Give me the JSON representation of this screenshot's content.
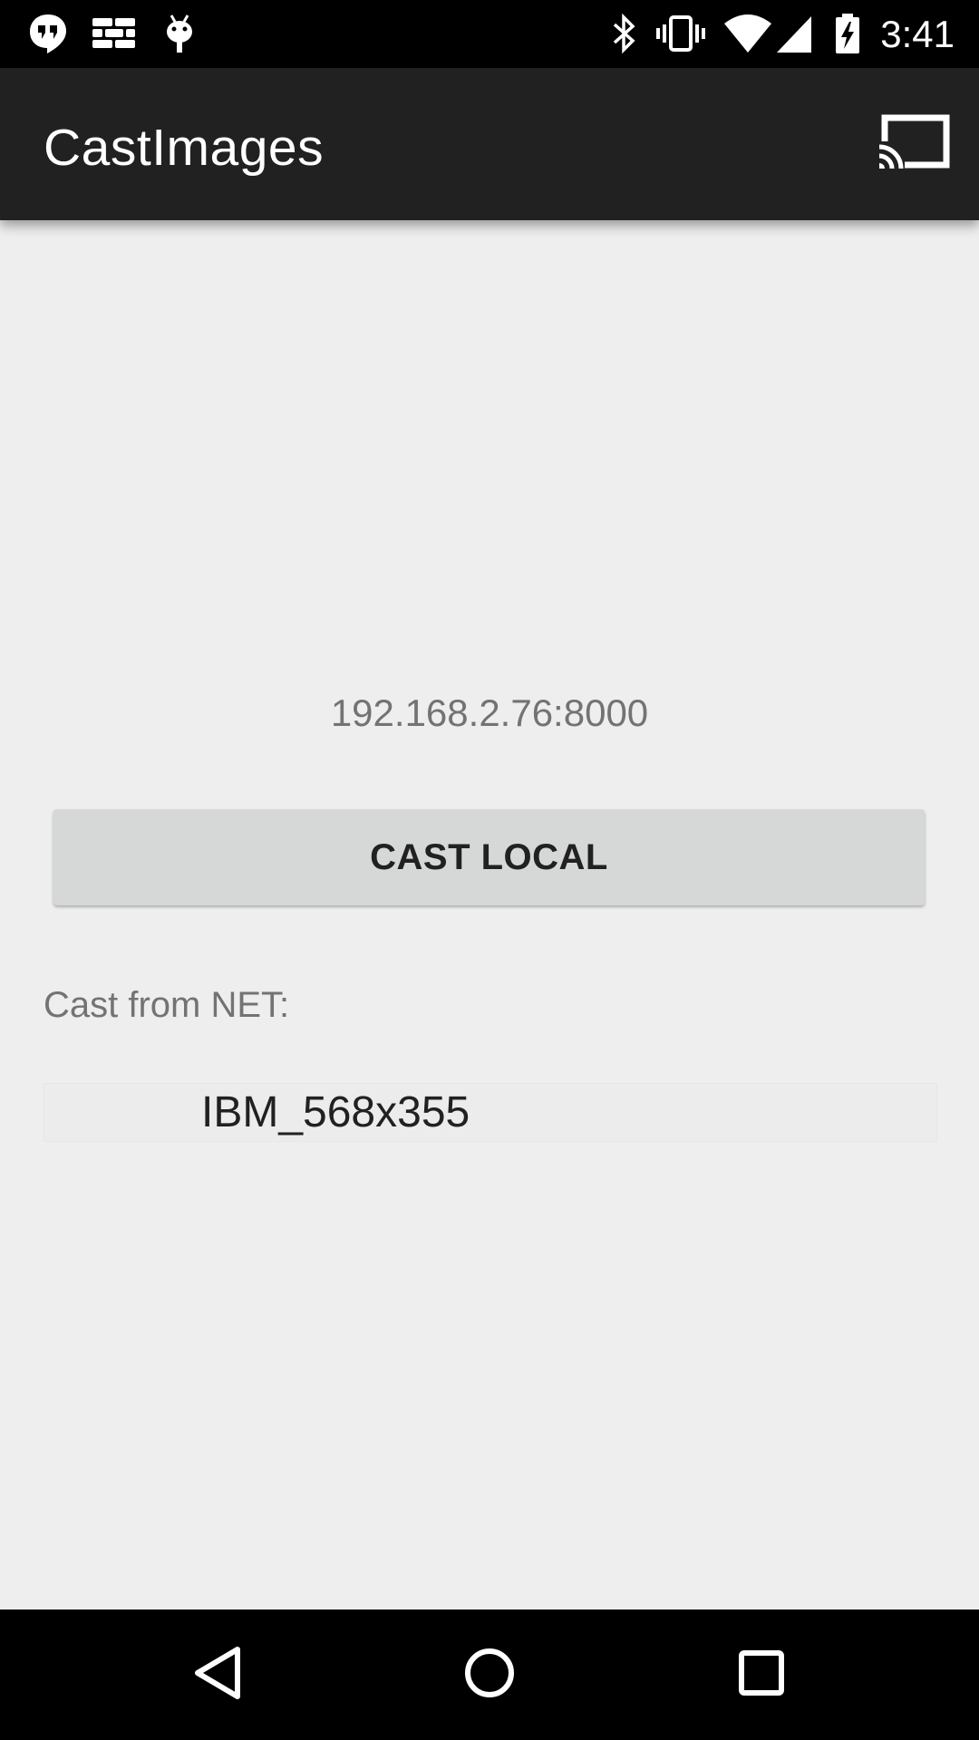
{
  "status_bar": {
    "time": "3:41",
    "left_icons": [
      "hangouts-icon",
      "bricks-icon",
      "android-debug-icon"
    ],
    "right_icons": [
      "bluetooth-icon",
      "vibrate-icon",
      "wifi-icon",
      "signal-icon",
      "battery-charging-icon"
    ]
  },
  "app_bar": {
    "title": "CastImages",
    "cast_icon": "cast-icon"
  },
  "main": {
    "server_address": "192.168.2.76:8000",
    "cast_local_label": "CAST LOCAL",
    "cast_from_net_label": "Cast from NET:",
    "net_items": [
      "IBM_568x355"
    ]
  },
  "nav_bar": {
    "icons": [
      "back-icon",
      "home-icon",
      "recents-icon"
    ]
  },
  "colors": {
    "status_bar": "#000000",
    "app_bar": "#212121",
    "background": "#eeeeee",
    "button": "#d6d7d7",
    "secondary_text": "#737373",
    "primary_text": "#212121"
  }
}
